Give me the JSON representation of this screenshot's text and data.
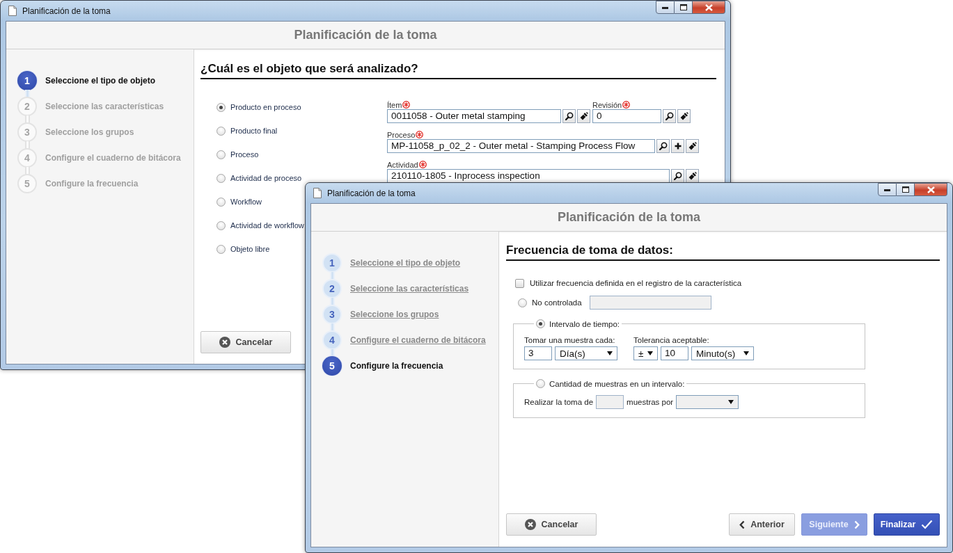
{
  "windows": [
    {
      "title": "Planificación de la toma",
      "header": "Planificación de la toma",
      "steps": [
        {
          "number": "1",
          "label": "Seleccione el tipo de objeto",
          "selected": true,
          "completed": false
        },
        {
          "number": "2",
          "label": "Seleccione las características",
          "selected": false,
          "completed": false
        },
        {
          "number": "3",
          "label": "Seleccione los grupos",
          "selected": false,
          "completed": false
        },
        {
          "number": "4",
          "label": "Configure el cuaderno de bitácora",
          "selected": false,
          "completed": false
        },
        {
          "number": "5",
          "label": "Configure la frecuencia",
          "selected": false,
          "completed": false
        }
      ],
      "content": {
        "kind": "object",
        "heading": "¿Cuál es el objeto que será analizado?",
        "options": [
          {
            "label": "Producto en proceso",
            "selected": true
          },
          {
            "label": "Producto final",
            "selected": false
          },
          {
            "label": "Proceso",
            "selected": false
          },
          {
            "label": "Actividad de proceso",
            "selected": false
          },
          {
            "label": "Workflow",
            "selected": false
          },
          {
            "label": "Actividad de workflow",
            "selected": false
          },
          {
            "label": "Objeto libre",
            "selected": false
          }
        ],
        "field_rows": [
          [
            {
              "label": "Ítem",
              "required": true,
              "value": "0011058 - Outer metal stamping",
              "actions": [
                {
                  "kind": "search"
                },
                {
                  "kind": "clear"
                }
              ]
            },
            {
              "label": "Revisión",
              "required": true,
              "value": "0",
              "actions": [
                {
                  "kind": "search"
                },
                {
                  "kind": "clear"
                }
              ]
            }
          ],
          [
            {
              "label": "Proceso",
              "required": true,
              "value": "MP-11058_p_02_2 - Outer metal - Stamping Process Flow",
              "actions": [
                {
                  "kind": "search"
                },
                {
                  "kind": "add"
                },
                {
                  "kind": "clear"
                }
              ]
            }
          ],
          [
            {
              "label": "Actividad",
              "required": true,
              "value": "210110-1805 - Inprocess inspection",
              "actions": [
                {
                  "kind": "search"
                },
                {
                  "kind": "clear"
                }
              ]
            }
          ]
        ],
        "buttons": [
          {
            "label": "Cancelar",
            "kind": "cancel",
            "disabled": false
          }
        ]
      }
    },
    {
      "title": "Planificación de la toma",
      "header": "Planificación de la toma",
      "steps": [
        {
          "number": "1",
          "label": "Seleccione el tipo de objeto",
          "selected": false,
          "completed": true
        },
        {
          "number": "2",
          "label": "Seleccione las características",
          "selected": false,
          "completed": true
        },
        {
          "number": "3",
          "label": "Seleccione los grupos",
          "selected": false,
          "completed": true
        },
        {
          "number": "4",
          "label": "Configure el cuaderno de bitácora",
          "selected": false,
          "completed": true
        },
        {
          "number": "5",
          "label": "Configure la frecuencia",
          "selected": true,
          "completed": false
        }
      ],
      "content": {
        "kind": "frequency",
        "heading": "Frecuencia de toma de datos:",
        "use_defined": {
          "label": "Utilizar frecuencia definida en el registro de la característica",
          "checked": false
        },
        "not_controlled": {
          "label": "No controlada",
          "selected": false,
          "field_disabled": true
        },
        "time_interval": {
          "label": "Intervalo de tiempo:",
          "selected": true,
          "every_label": "Tomar una muestra cada:",
          "every_value": "3",
          "every_unit": "Día(s)",
          "tolerance_label": "Tolerancia aceptable:",
          "tolerance_sign": "±",
          "tolerance_value": "10",
          "tolerance_unit": "Minuto(s)"
        },
        "sample_count": {
          "label": "Cantidad de muestras en un intervalo:",
          "selected": false,
          "prefix": "Realizar la toma de",
          "middle": "muestras por",
          "fields_disabled": true
        },
        "buttons": [
          {
            "label": "Cancelar",
            "kind": "cancel",
            "disabled": false
          },
          {
            "label": "Anterior",
            "kind": "back",
            "disabled": false
          },
          {
            "label": "Siguiente",
            "kind": "next",
            "disabled": true
          },
          {
            "label": "Finalizar",
            "kind": "finish",
            "disabled": false
          }
        ]
      }
    }
  ]
}
